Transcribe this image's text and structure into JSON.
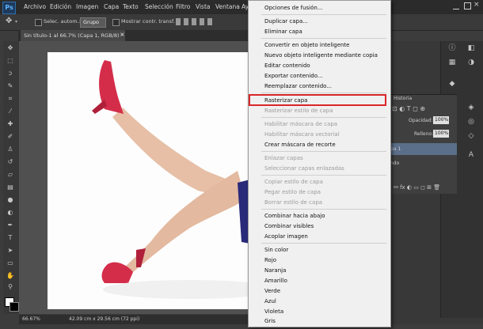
{
  "app": {
    "logo": "Ps"
  },
  "menu": [
    "Archivo",
    "Edición",
    "Imagen",
    "Capa",
    "Texto",
    "Selección",
    "Filtro",
    "Vista",
    "Ventana",
    "Ay"
  ],
  "options": {
    "auto_select_label": "Selec. autom.:",
    "auto_select_value": "Grupo",
    "show_transform_label": "Mostrar contr. transf."
  },
  "document": {
    "tab_title": "Sin título-1 al 66.7% (Capa 1, RGB/8) *",
    "close_glyph": "×"
  },
  "status": {
    "zoom": "66.67%",
    "doc_info": "42.09 cm x 29.56 cm (72 ppi)"
  },
  "panels": {
    "history_tab": "Historia",
    "opacity_label": "Opacidad:",
    "opacity_value": "100%",
    "fill_label": "Relleno:",
    "fill_value": "100%",
    "layer_1": "pa 1",
    "layer_bg": "ndo"
  },
  "context_menu": {
    "items": [
      {
        "label": "Opciones de fusión...",
        "enabled": true
      },
      {
        "label": "Duplicar capa...",
        "enabled": true
      },
      {
        "label": "Eliminar capa",
        "enabled": true
      },
      {
        "label": "Convertir en objeto inteligente",
        "enabled": true
      },
      {
        "label": "Nuevo objeto inteligente mediante copia",
        "enabled": true
      },
      {
        "label": "Editar contenido",
        "enabled": true
      },
      {
        "label": "Exportar contenido...",
        "enabled": true
      },
      {
        "label": "Reemplazar contenido...",
        "enabled": true
      },
      {
        "label": "Rasterizar capa",
        "enabled": true,
        "highlighted": true
      },
      {
        "label": "Rasterizar estilo de capa",
        "enabled": false
      },
      {
        "label": "Habilitar máscara de capa",
        "enabled": false
      },
      {
        "label": "Habilitar máscara vectorial",
        "enabled": false
      },
      {
        "label": "Crear máscara de recorte",
        "enabled": true
      },
      {
        "label": "Enlazar capas",
        "enabled": false
      },
      {
        "label": "Seleccionar capas enlazadas",
        "enabled": false
      },
      {
        "label": "Copiar estilo de capa",
        "enabled": false
      },
      {
        "label": "Pegar estilo de capa",
        "enabled": false
      },
      {
        "label": "Borrar estilo de capa",
        "enabled": false
      },
      {
        "label": "Combinar hacia abajo",
        "enabled": true
      },
      {
        "label": "Combinar visibles",
        "enabled": true
      },
      {
        "label": "Acoplar imagen",
        "enabled": true
      },
      {
        "label": "Sin color",
        "enabled": true
      },
      {
        "label": "Rojo",
        "enabled": true
      },
      {
        "label": "Naranja",
        "enabled": true
      },
      {
        "label": "Amarillo",
        "enabled": true
      },
      {
        "label": "Verde",
        "enabled": true
      },
      {
        "label": "Azul",
        "enabled": true
      },
      {
        "label": "Violeta",
        "enabled": true
      },
      {
        "label": "Gris",
        "enabled": true
      }
    ]
  },
  "colors": {
    "highlight_border": "#d9262a",
    "shoe": "#d42d4a",
    "skin": "#e6bfa6",
    "skirt": "#2a2a7a"
  }
}
